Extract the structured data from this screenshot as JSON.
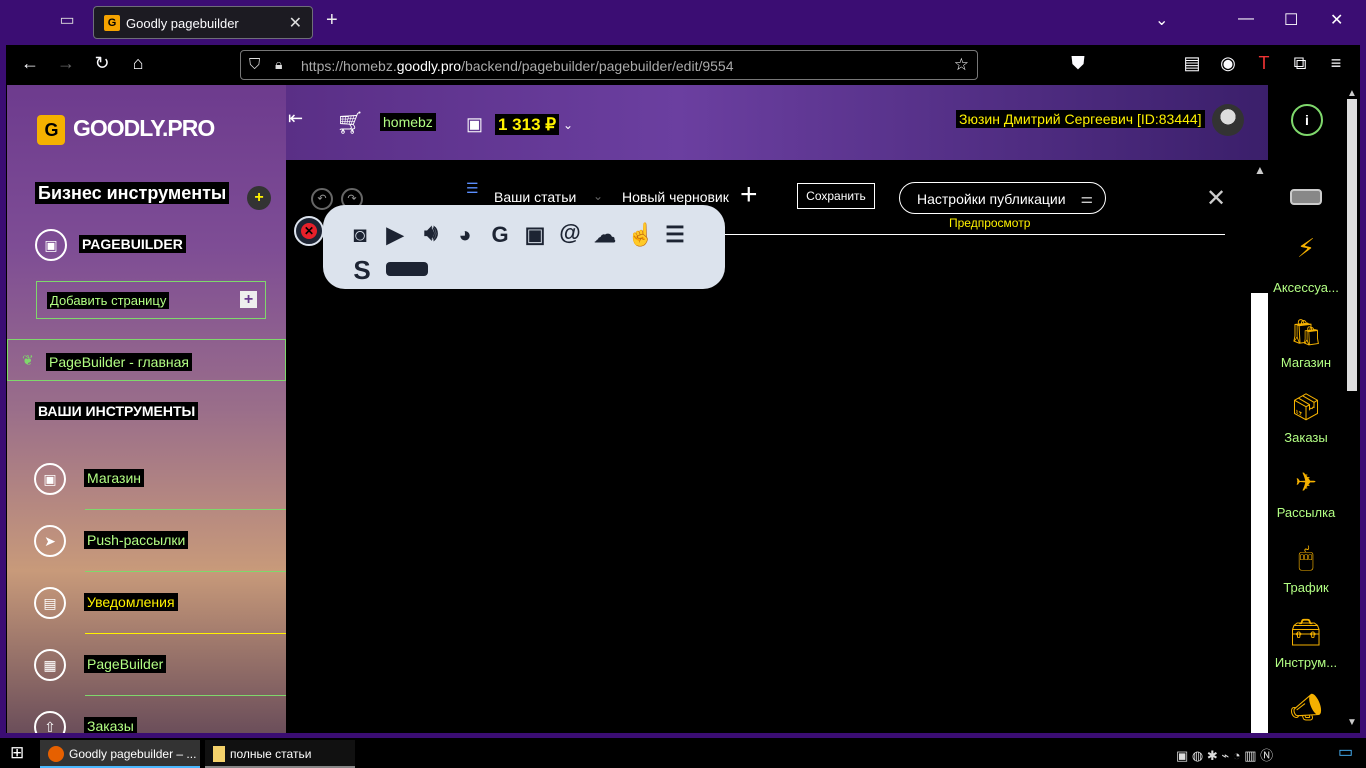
{
  "browser": {
    "tab_title": "Goodly pagebuilder",
    "url_prefix": "https://homebz.",
    "url_domain": "goodly.pro",
    "url_path": "/backend/pagebuilder/pagebuilder/edit/9554"
  },
  "sidebar": {
    "logo": "GOODLY.PRO",
    "logo_letter": "G",
    "section1": "Бизнес инструменты",
    "pagebuilder": "PAGEBUILDER",
    "add_page": "Добавить страницу",
    "active_page": "PageBuilder - главная",
    "section2": "ВАШИ ИНСТРУМЕНТЫ",
    "items": [
      {
        "label": "Магазин",
        "color": "green"
      },
      {
        "label": "Push-рассылки",
        "color": "green"
      },
      {
        "label": "Уведомления",
        "color": "yellow"
      },
      {
        "label": "PageBuilder",
        "color": "green"
      },
      {
        "label": "Заказы",
        "color": "green"
      }
    ]
  },
  "header": {
    "site": "homebz",
    "balance": "1 313 ₽",
    "user": "Зюзин Дмитрий Сергеевич [ID:83444]"
  },
  "editor": {
    "articles": "Ваши статьи",
    "new_draft": "Новый черновик",
    "save": "Сохранить",
    "publish_settings": "Настройки публикации",
    "preview": "Предпросмотр"
  },
  "rightbar": {
    "items": [
      "Аксессуа...",
      "Магазин",
      "Заказы",
      "Рассылка",
      "Трафик",
      "Инструм..."
    ]
  },
  "taskbar": {
    "app1": "Goodly pagebuilder – ...",
    "app2": "полные статьи"
  }
}
